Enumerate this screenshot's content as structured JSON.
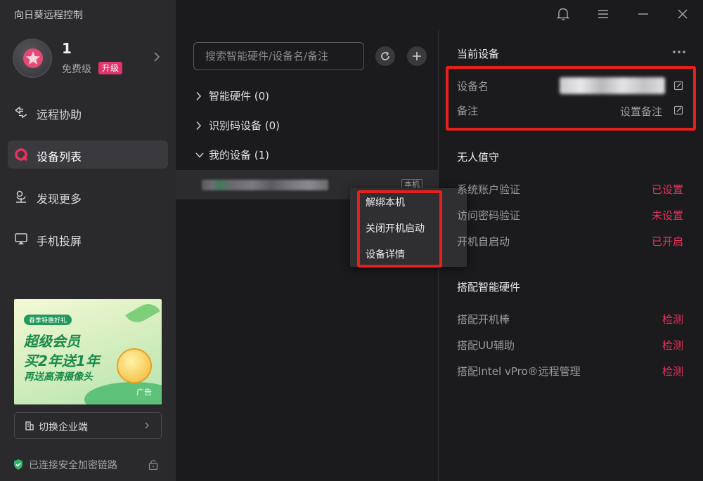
{
  "app": {
    "title": "向日葵远程控制"
  },
  "profile": {
    "name": "1",
    "level": "免费级",
    "upgrade": "升级"
  },
  "nav": [
    {
      "label": "远程协助",
      "icon": "remote-assist-icon"
    },
    {
      "label": "设备列表",
      "icon": "device-list-icon",
      "active": true
    },
    {
      "label": "发现更多",
      "icon": "discover-icon"
    },
    {
      "label": "手机投屏",
      "icon": "screen-cast-icon"
    }
  ],
  "ad": {
    "tag": "春季特惠好礼",
    "line1": "超级会员",
    "line2": "买2年送1年",
    "line3": "再送高清摄像头",
    "label": "广告"
  },
  "enterprise": {
    "label": "切换企业端"
  },
  "status": {
    "secure": "已连接安全加密链路"
  },
  "search": {
    "placeholder": "搜索智能硬件/设备名/备注"
  },
  "tree": [
    {
      "label": "智能硬件 (0)",
      "expanded": false
    },
    {
      "label": "识别码设备 (0)",
      "expanded": false
    },
    {
      "label": "我的设备 (1)",
      "expanded": true
    }
  ],
  "device": {
    "badge": "本机"
  },
  "context_menu": {
    "items": [
      "解绑本机",
      "关闭开机启动",
      "设备详情"
    ]
  },
  "current_device": {
    "title": "当前设备",
    "name_label": "设备名",
    "remark_label": "备注",
    "remark_value": "设置备注"
  },
  "unattended": {
    "title": "无人值守",
    "rows": [
      {
        "label": "系统账户验证",
        "value": "已设置"
      },
      {
        "label": "访问密码验证",
        "value": "未设置"
      },
      {
        "label": "开机自启动",
        "value": "已开启"
      }
    ]
  },
  "hardware": {
    "title": "搭配智能硬件",
    "rows": [
      {
        "label": "搭配开机棒",
        "value": "检测"
      },
      {
        "label": "搭配UU辅助",
        "value": "检测"
      },
      {
        "label": "搭配Intel vPro®远程管理",
        "value": "检测"
      }
    ]
  },
  "colors": {
    "accent": "#e8325c",
    "highlight": "#e8201c",
    "badge": "#e0356a",
    "success": "#34b36b"
  }
}
